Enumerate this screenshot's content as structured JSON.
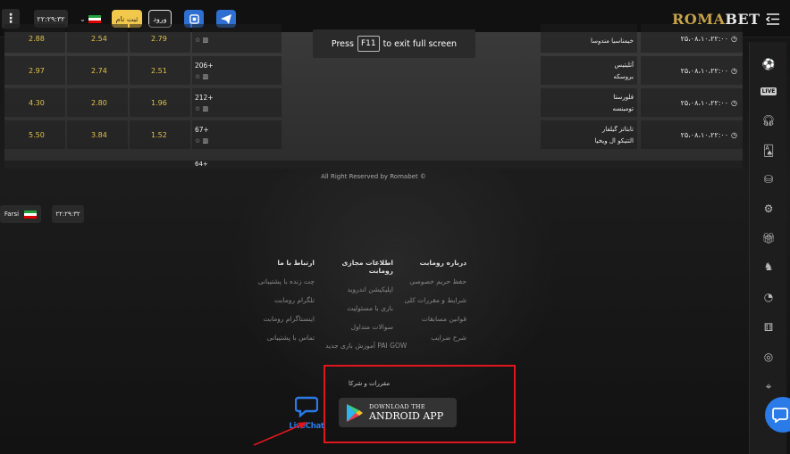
{
  "topbar": {
    "menu_dots": "⋮",
    "clock": "۲۲:۲۹:۳۲",
    "register_label": "ثبت نام",
    "login_label": "ورود",
    "logo_roma": "ROMA",
    "logo_bet": "BET"
  },
  "fullscreen_toast": {
    "press": "Press",
    "key": "F11",
    "rest": "to exit full screen"
  },
  "matches": [
    {
      "odd1": "2.88",
      "oddx": "2.54",
      "odd2": "2.79",
      "more": "",
      "team1": "",
      "team2": "خیمناسیا مندوسا",
      "time": "۲۵،۰۸،۱۰،۲۲:۰۰"
    },
    {
      "odd1": "2.97",
      "oddx": "2.74",
      "odd2": "2.51",
      "more": "206+",
      "team1": "آتلیتیس",
      "team2": "بروسکه",
      "time": "۲۵،۰۸،۱۰،۲۲:۰۰"
    },
    {
      "odd1": "4.30",
      "oddx": "2.80",
      "odd2": "1.96",
      "more": "212+",
      "team1": "فلورستا",
      "team2": "تومبنسه",
      "time": "۲۵،۰۸،۱۰،۲۲:۰۰"
    },
    {
      "odd1": "5.50",
      "oddx": "3.84",
      "odd2": "1.52",
      "more": "67+",
      "team1": "تابتاتز گیلفار",
      "team2": "التتیکو ال ویخیا",
      "time": "۲۵،۰۸،۱۰،۲۲:۰۰"
    }
  ],
  "partial_row": {
    "more": "64+"
  },
  "footer": {
    "rights": "All Right Reserved by Romabet ©",
    "lang": "Farsi",
    "clock": "۲۲:۲۹:۳۲",
    "columns": [
      {
        "title": "درباره رومابت",
        "links": [
          "حفظ حریم خصوصی",
          "شرایط و مقررات کلی",
          "قوانین مسابقات",
          "شرح ضرایب"
        ]
      },
      {
        "title": "اطلاعات مجازی رومابت",
        "links": [
          "اپلیکیشن اندروید",
          "بازی با مسئولیت",
          "سوالات متداول",
          "آموزش بازی جدید PAI GOW"
        ]
      },
      {
        "title": "ارتباط با ما",
        "links": [
          "چت زنده با پشتیبانی",
          "تلگرام رومابت",
          "اینستاگرام رومابت",
          "تماس با پشتیبانی"
        ]
      }
    ],
    "app_section_label": "مقررات و شرکا",
    "app_small": "DOWNLOAD THE",
    "app_big": "ANDROID APP",
    "livechat_label": "LiveChat"
  },
  "colors": {
    "accent_yellow": "#f1c84b",
    "accent_blue": "#2e6fd1",
    "highlight_red": "#e0161c",
    "odds_gold": "#e0c24a"
  }
}
